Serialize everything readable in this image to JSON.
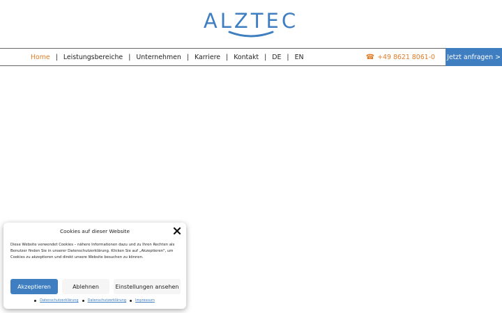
{
  "brand": {
    "logo_text": "ALZTEC",
    "color": "#3e7ec1"
  },
  "nav": {
    "items": [
      {
        "label": "Home",
        "active": true
      },
      {
        "label": "Leistungsbereiche"
      },
      {
        "label": "Unternehmen"
      },
      {
        "label": "Karriere"
      },
      {
        "label": "Kontakt"
      },
      {
        "label": "DE"
      },
      {
        "label": "EN"
      }
    ],
    "separator": "|",
    "phone": "+49 8621 8061-0",
    "phone_icon": "phone-icon",
    "cta_label": "Jetzt anfragen >"
  },
  "cookie": {
    "title": "Cookies auf dieser Website",
    "text": "Diese Website verwendet Cookies – nähere Informationen dazu und zu Ihren Rechten als Benutzer finden Sie in unserer Datenschutzerklärung. Klicken Sie auf „Akzeptieren\", um Cookies zu akzeptieren und direkt unsere Website besuchen zu können.",
    "accept_label": "Akzeptieren",
    "deny_label": "Ablehnen",
    "prefs_label": "Einstellungen ansehen",
    "links": [
      "Datenschutzerklärung",
      "Datenschutzerklärung",
      "Impressum"
    ]
  }
}
